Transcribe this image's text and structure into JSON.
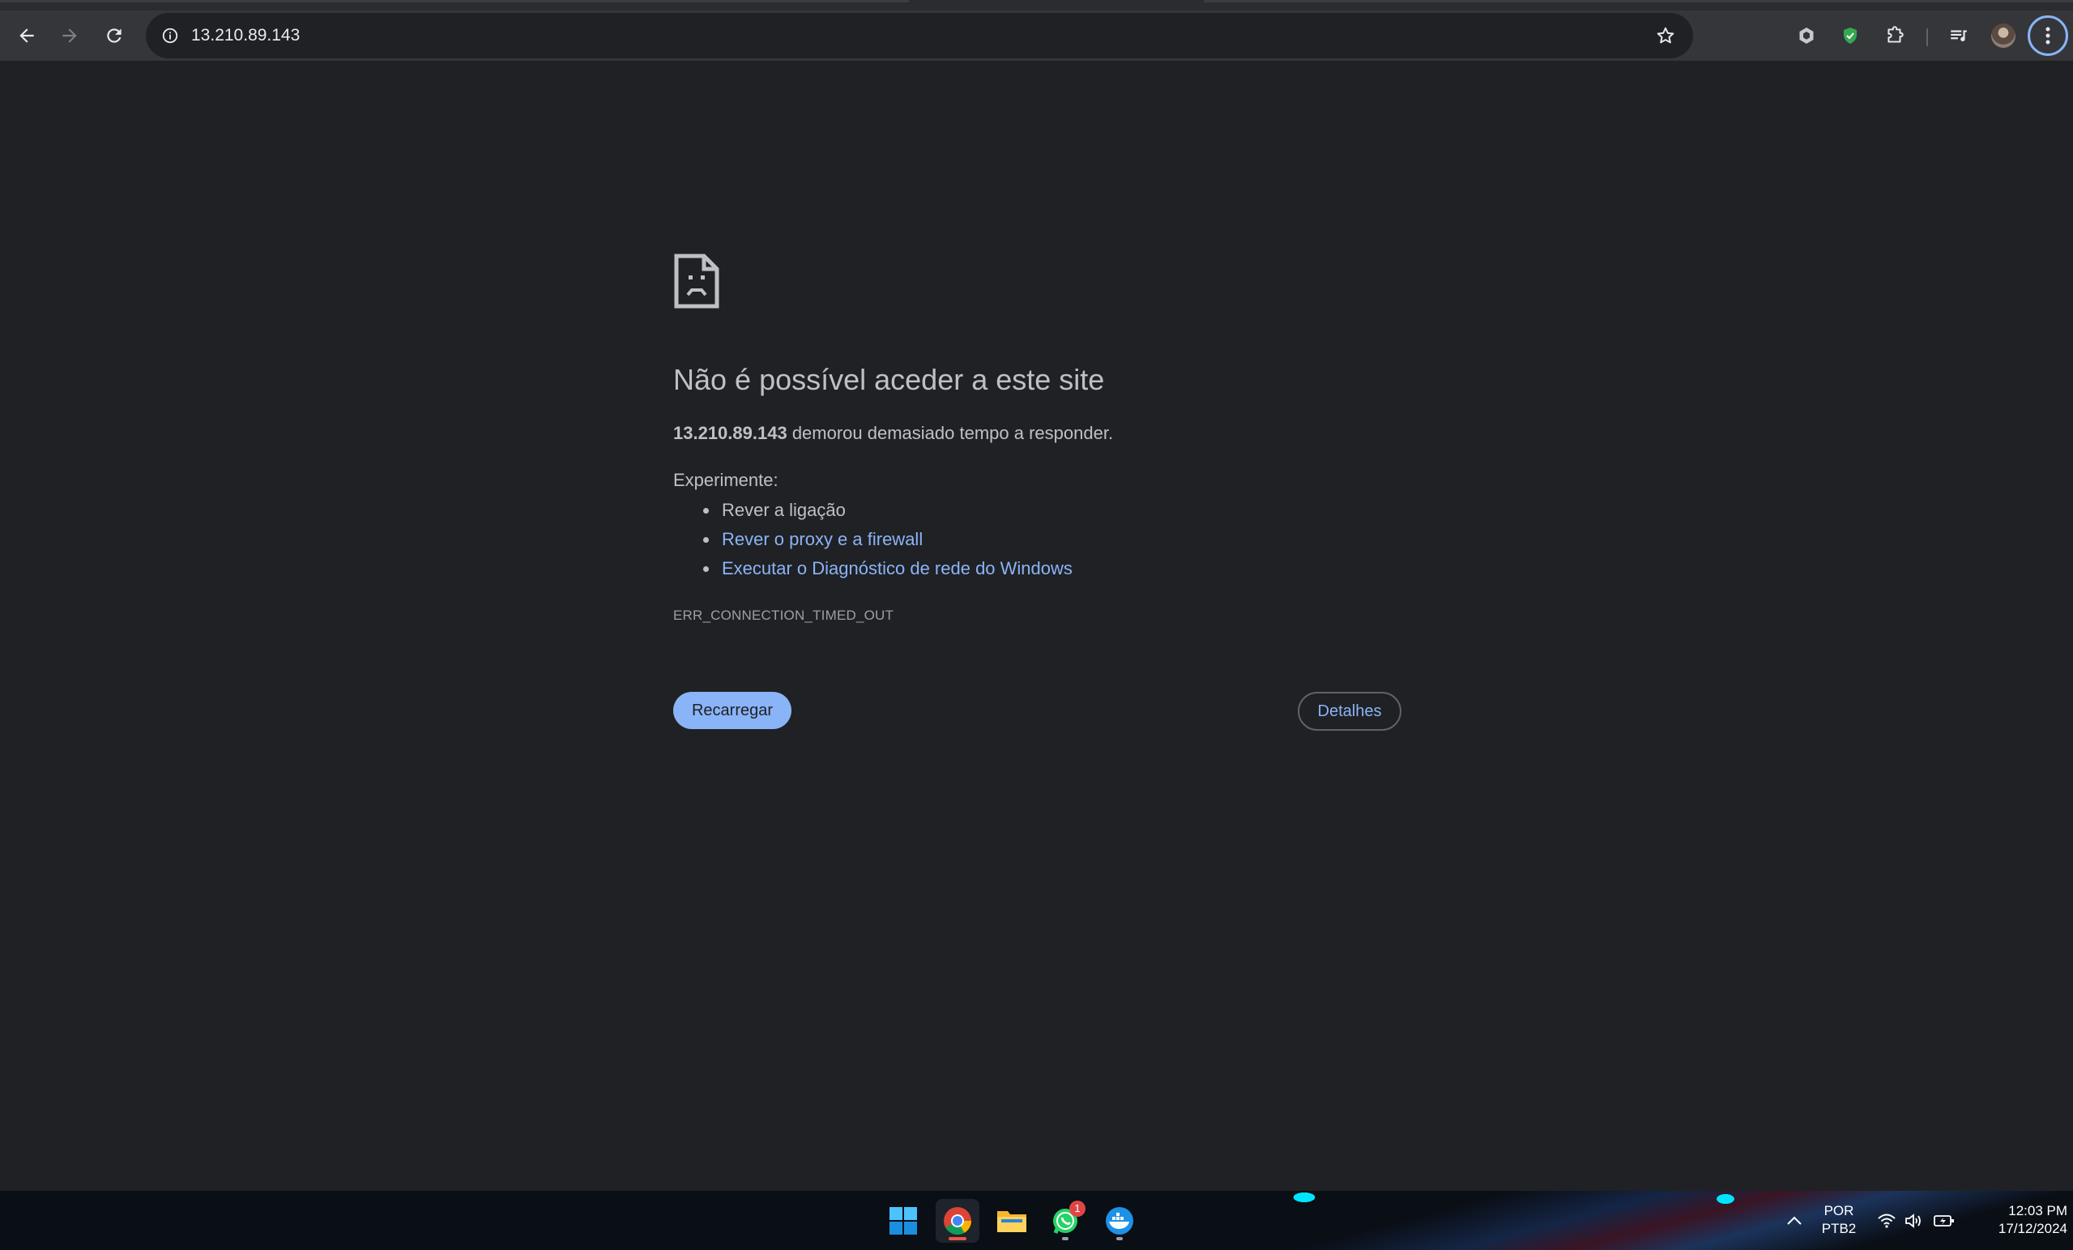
{
  "browser": {
    "url": "13.210.89.143",
    "icons": {
      "back": "arrow-left-icon",
      "forward": "arrow-right-icon",
      "reload": "reload-icon",
      "info": "info-icon",
      "bookmark": "star-icon",
      "extension_1": "hexagon-icon",
      "extension_2": "shield-icon",
      "extensions": "puzzle-icon",
      "media": "media-queue-icon",
      "menu": "kebab-menu-icon"
    }
  },
  "error_page": {
    "title": "Não é possível aceder a este site",
    "host": "13.210.89.143",
    "summary_suffix": " demorou demasiado tempo a responder.",
    "suggestions_heading": "Experimente:",
    "suggestions": [
      {
        "text": "Rever a ligação",
        "is_link": false
      },
      {
        "text": "Rever o proxy e a firewall",
        "is_link": true
      },
      {
        "text": "Executar o Diagnóstico de rede do Windows",
        "is_link": true
      }
    ],
    "error_code": "ERR_CONNECTION_TIMED_OUT",
    "reload_button": "Recarregar",
    "details_button": "Detalhes"
  },
  "taskbar": {
    "apps": [
      "windows-start",
      "chrome",
      "file-explorer",
      "whatsapp",
      "docker"
    ],
    "whatsapp_badge": "1",
    "language_line1": "POR",
    "language_line2": "PTB2",
    "time": "12:03 PM",
    "date": "17/12/2024"
  },
  "colors": {
    "page_bg": "#202124",
    "toolbar_bg": "#35363a",
    "link": "#8ab4f8",
    "text": "#bdc1c6"
  }
}
